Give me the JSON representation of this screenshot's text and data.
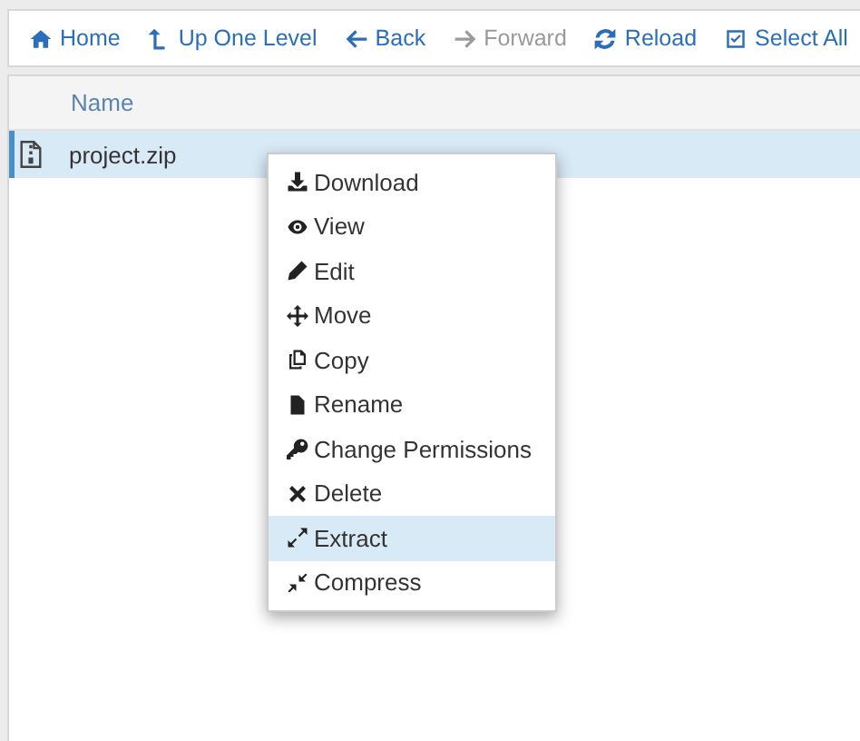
{
  "toolbar": [
    {
      "kind": "home",
      "label": "Home",
      "disabled": false
    },
    {
      "kind": "up",
      "label": "Up One Level",
      "disabled": false
    },
    {
      "kind": "back",
      "label": "Back",
      "disabled": false
    },
    {
      "kind": "forward",
      "label": "Forward",
      "disabled": true
    },
    {
      "kind": "reload",
      "label": "Reload",
      "disabled": false
    },
    {
      "kind": "select",
      "label": "Select All",
      "disabled": false
    }
  ],
  "table": {
    "columns": [
      "Name"
    ],
    "rows": [
      {
        "name": "project.zip",
        "selected": true
      }
    ]
  },
  "context_menu": [
    {
      "kind": "download",
      "label": "Download",
      "selected": false
    },
    {
      "kind": "view",
      "label": "View",
      "selected": false
    },
    {
      "kind": "edit",
      "label": "Edit",
      "selected": false
    },
    {
      "kind": "move",
      "label": "Move",
      "selected": false
    },
    {
      "kind": "copy",
      "label": "Copy",
      "selected": false
    },
    {
      "kind": "rename",
      "label": "Rename",
      "selected": false
    },
    {
      "kind": "key",
      "label": "Change Permissions",
      "selected": false
    },
    {
      "kind": "delete",
      "label": "Delete",
      "selected": false
    },
    {
      "kind": "extract",
      "label": "Extract",
      "selected": true
    },
    {
      "kind": "compress",
      "label": "Compress",
      "selected": false
    }
  ]
}
